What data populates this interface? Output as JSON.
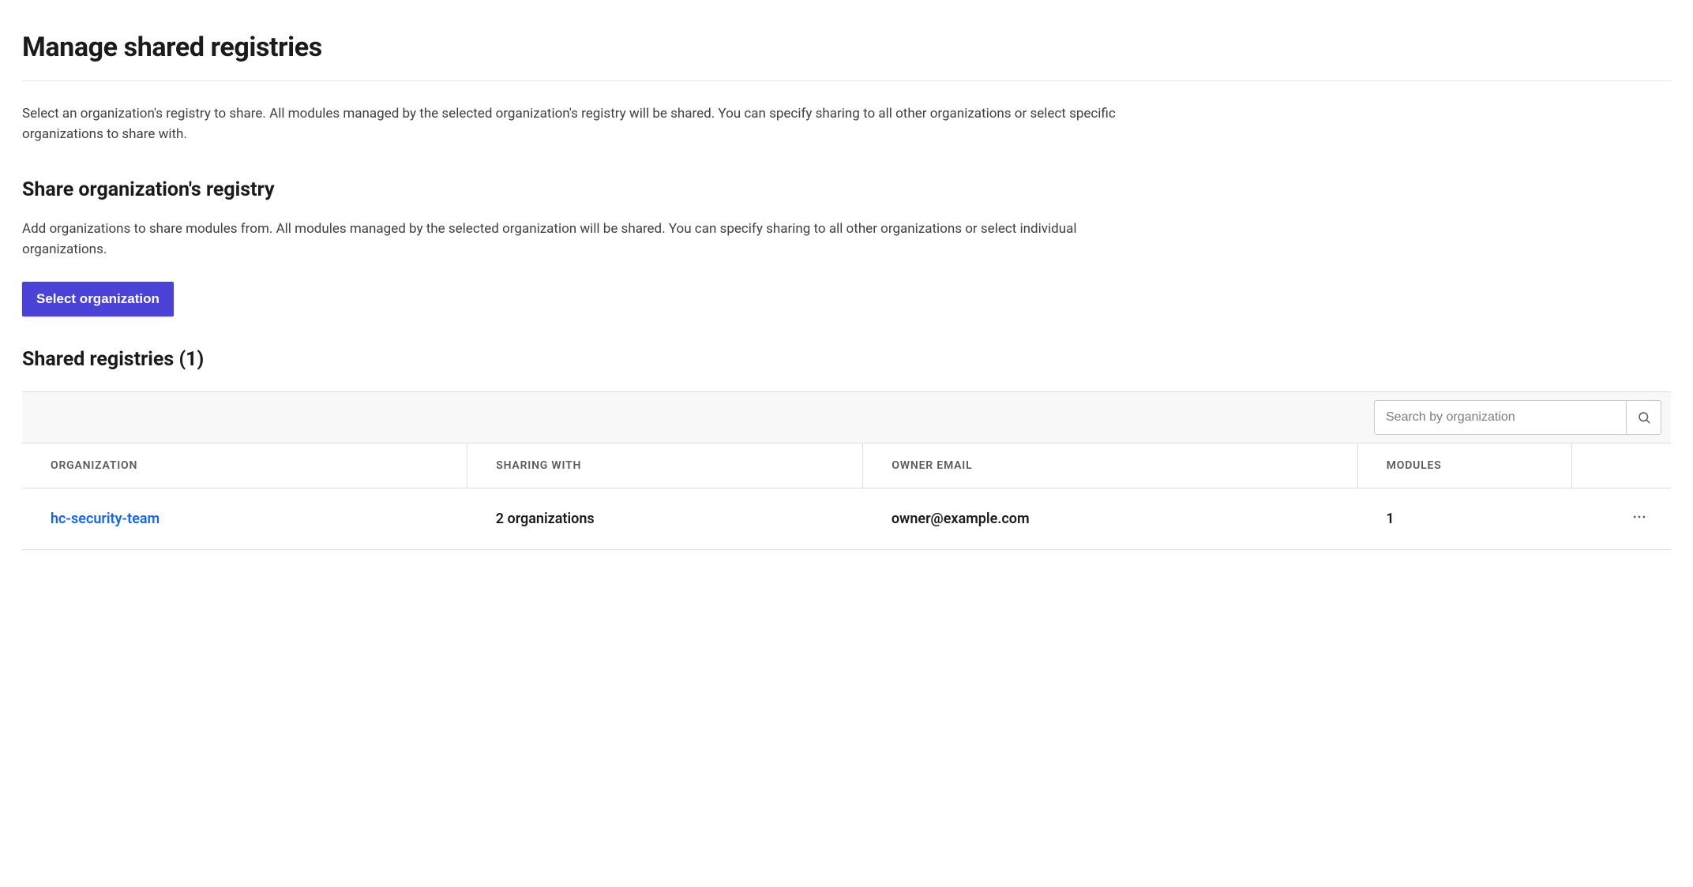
{
  "page": {
    "title": "Manage shared registries",
    "intro": "Select an organization's registry to share. All modules managed by the selected organization's registry will be shared. You can specify sharing to all other organizations or select specific organizations to share with."
  },
  "share_section": {
    "title": "Share organization's registry",
    "description": "Add organizations to share modules from. All modules managed by the selected organization will be shared. You can specify sharing to all other organizations or select individual organizations.",
    "button_label": "Select organization"
  },
  "shared": {
    "title": "Shared registries (1)",
    "search_placeholder": "Search by organization",
    "columns": {
      "org": "ORGANIZATION",
      "sharing": "SHARING WITH",
      "email": "OWNER EMAIL",
      "modules": "MODULES"
    },
    "rows": [
      {
        "org": "hc-security-team",
        "sharing": "2 organizations",
        "email": "owner@example.com",
        "modules": "1"
      }
    ]
  }
}
